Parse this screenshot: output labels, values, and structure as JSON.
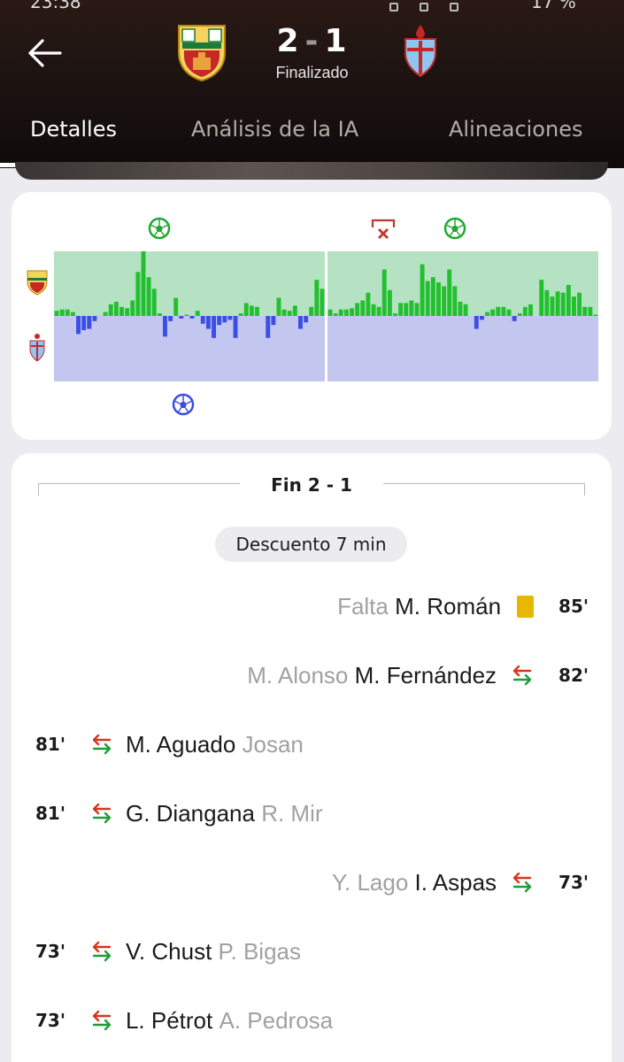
{
  "status_bar": {
    "time": "23:38",
    "battery": "17 %"
  },
  "header": {
    "back_icon": "arrow-left-icon",
    "home_team_crest": "elche-crest-icon",
    "away_team_crest": "celta-crest-icon",
    "score_home": "2",
    "score_away": "1",
    "status": "Finalizado",
    "tabs": [
      {
        "label": "Detalles",
        "active": true
      },
      {
        "label": "Análisis de la IA",
        "active": false
      },
      {
        "label": "Alineaciones",
        "active": false
      }
    ]
  },
  "colors": {
    "home_positive": "#22c02f",
    "home_area": "#b6e2c4",
    "away_negative": "#3b4fe4",
    "away_area": "#c3c7f0",
    "yellow_card": "#e6b800",
    "sub_out": "#d4371e",
    "sub_in": "#1f9d3b"
  },
  "momentum": {
    "home_marker_icons": [
      "soccer-ball-icon",
      "missed-penalty-icon",
      "soccer-ball-icon"
    ],
    "away_marker_icons": [
      "soccer-ball-icon"
    ],
    "first_half": [
      0.08,
      0.1,
      0.1,
      0.06,
      -0.28,
      -0.22,
      -0.2,
      -0.08,
      0.0,
      0.06,
      0.18,
      0.22,
      0.14,
      0.12,
      0.24,
      0.68,
      1.0,
      0.6,
      0.42,
      0.04,
      -0.32,
      -0.08,
      0.28,
      -0.04,
      0.02,
      -0.04,
      0.08,
      -0.12,
      -0.2,
      -0.34,
      -0.14,
      -0.1,
      -0.06,
      -0.34,
      0.04,
      0.2,
      0.16,
      0.14,
      0.0,
      -0.34,
      -0.14,
      0.28,
      0.1,
      0.08,
      0.16,
      -0.2,
      -0.1,
      0.14,
      0.56,
      0.42
    ],
    "second_half": [
      0.1,
      0.04,
      0.1,
      0.1,
      0.12,
      0.2,
      0.24,
      0.36,
      0.18,
      0.14,
      0.72,
      0.4,
      0.04,
      0.2,
      0.2,
      0.24,
      0.2,
      0.8,
      0.54,
      0.6,
      0.52,
      0.46,
      0.72,
      0.46,
      0.22,
      0.18,
      0.0,
      -0.2,
      -0.06,
      0.06,
      0.1,
      0.14,
      0.14,
      0.1,
      -0.08,
      0.04,
      0.14,
      0.18,
      0.0,
      0.56,
      0.4,
      0.3,
      0.38,
      0.36,
      0.48,
      0.3,
      0.36,
      0.14,
      0.14,
      0.02
    ]
  },
  "events": {
    "final_label": "Fin 2 - 1",
    "stoppage": "Descuento 7 min",
    "items": [
      {
        "side": "right",
        "type": "yellow-card",
        "secondary": "Falta",
        "primary": "M. Román",
        "minute": "85'"
      },
      {
        "side": "right",
        "type": "substitution",
        "secondary": "M. Alonso",
        "primary": "M. Fernández",
        "minute": "82'"
      },
      {
        "side": "left",
        "type": "substitution",
        "primary": "M. Aguado",
        "secondary": "Josan",
        "minute": "81'"
      },
      {
        "side": "left",
        "type": "substitution",
        "primary": "G. Diangana",
        "secondary": "R. Mir",
        "minute": "81'"
      },
      {
        "side": "right",
        "type": "substitution",
        "secondary": "Y. Lago",
        "primary": "I. Aspas",
        "minute": "73'"
      },
      {
        "side": "left",
        "type": "substitution",
        "primary": "V. Chust",
        "secondary": "P. Bigas",
        "minute": "73'"
      },
      {
        "side": "left",
        "type": "substitution",
        "primary": "L. Pétrot",
        "secondary": "A. Pedrosa",
        "minute": "73'"
      }
    ]
  }
}
